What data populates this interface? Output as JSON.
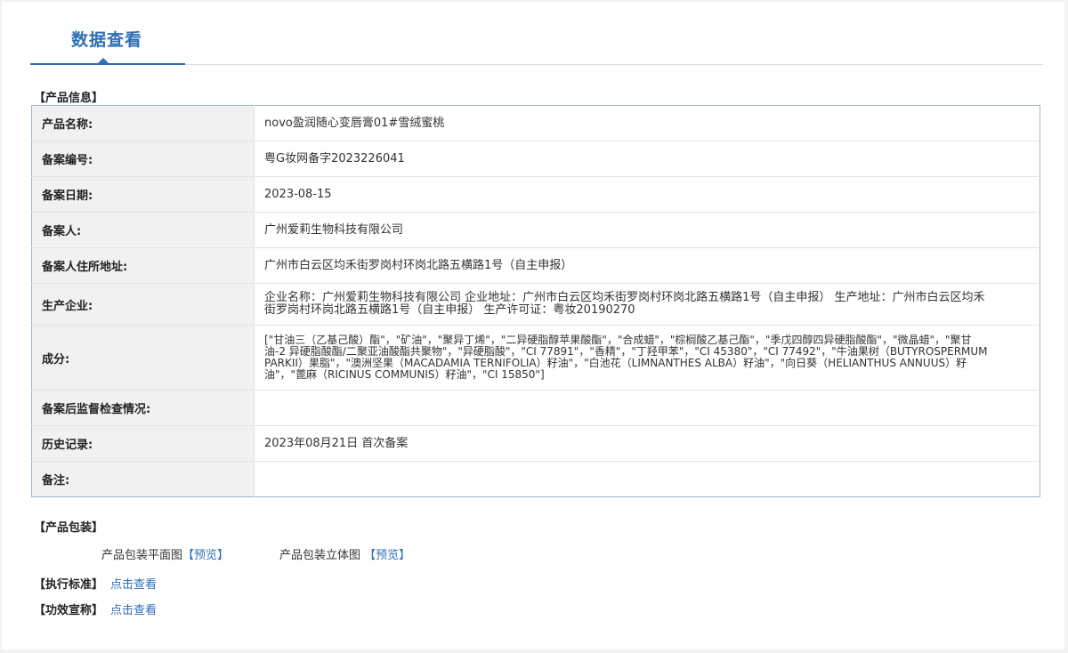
{
  "header": {
    "title": "数据查看"
  },
  "product_info": {
    "section_title": "【产品信息】",
    "rows": [
      {
        "label": "产品名称:",
        "value": "novo盈润随心变唇膏01#雪绒蜜桃"
      },
      {
        "label": "备案编号:",
        "value": "粤G妆网备字2023226041"
      },
      {
        "label": "备案日期:",
        "value": "2023-08-15"
      },
      {
        "label": "备案人:",
        "value": "广州爱莉生物科技有限公司"
      },
      {
        "label": "备案人住所地址:",
        "value": "广州市白云区均禾街罗岗村环岗北路五横路1号（自主申报）"
      },
      {
        "label": "生产企业:",
        "value": "企业名称：广州爱莉生物科技有限公司 企业地址：广州市白云区均禾街罗岗村环岗北路五横路1号（自主申报） 生产地址：广州市白云区均禾街罗岗村环岗北路五横路1号（自主申报） 生产许可证：粤妆20190270"
      },
      {
        "label": "成分:",
        "value": "[\"甘油三（乙基己酸）酯\"，\"矿油\"，\"聚异丁烯\"，\"二异硬脂醇苹果酸酯\"，\"合成蜡\"，\"棕榈酸乙基己酯\"，\"季戊四醇四异硬脂酸酯\"，\"微晶蜡\"，\"聚甘油-2 异硬脂酸酯/二聚亚油酸酯共聚物\"，\"异硬脂酸\"，\"CI 77891\"，\"香精\"，\"丁羟甲苯\"，\"CI 45380\"，\"CI 77492\"，\"牛油果树（BUTYROSPERMUM PARKII）果脂\"，\"澳洲坚果（MACADAMIA TERNIFOLIA）籽油\"，\"白池花（LIMNANTHES ALBA）籽油\"，\"向日葵（HELIANTHUS ANNUUS）籽油\"，\"蓖麻（RICINUS COMMUNIS）籽油\"，\"CI 15850\"]"
      },
      {
        "label": "备案后监督检查情况:",
        "value": ""
      },
      {
        "label": "历史记录:",
        "value": "2023年08月21日 首次备案"
      },
      {
        "label": "备注:",
        "value": ""
      }
    ]
  },
  "packaging": {
    "section_title": "【产品包装】",
    "flat_label": "产品包装平面图",
    "flat_link": "【预览】",
    "solid_label": "产品包装立体图",
    "solid_link": "【预览】"
  },
  "standard": {
    "label": "【执行标准】",
    "link": "点击查看"
  },
  "efficacy": {
    "label": "【功效宣称】",
    "link": "点击查看"
  },
  "colors": {
    "accent": "#2f6fb5",
    "table_border": "#9bb6d8",
    "key_bg": "#f1f1f1"
  }
}
